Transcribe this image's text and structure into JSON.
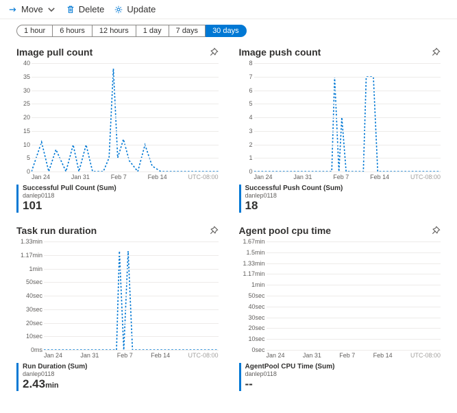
{
  "toolbar": {
    "move": "Move",
    "delete": "Delete",
    "update": "Update"
  },
  "time_ranges": [
    "1 hour",
    "6 hours",
    "12 hours",
    "1 day",
    "7 days",
    "30 days"
  ],
  "time_selected": 5,
  "x_labels": [
    "Jan 24",
    "Jan 31",
    "Feb 7",
    "Feb 14"
  ],
  "tz": "UTC-08:00",
  "cards": {
    "pull": {
      "title": "Image pull count",
      "y_ticks": [
        "40",
        "35",
        "30",
        "25",
        "20",
        "15",
        "10",
        "5",
        "0"
      ],
      "legend_name": "Successful Pull Count (Sum)",
      "legend_sub": "danlep0118",
      "legend_val": "101",
      "legend_unit": ""
    },
    "push": {
      "title": "Image push count",
      "y_ticks": [
        "8",
        "7",
        "6",
        "5",
        "4",
        "3",
        "2",
        "1",
        "0"
      ],
      "legend_name": "Successful Push Count (Sum)",
      "legend_sub": "danlep0118",
      "legend_val": "18",
      "legend_unit": ""
    },
    "task": {
      "title": "Task run duration",
      "y_ticks": [
        "1.33min",
        "1.17min",
        "1min",
        "50sec",
        "40sec",
        "30sec",
        "20sec",
        "10sec",
        "0ms"
      ],
      "legend_name": "Run Duration (Sum)",
      "legend_sub": "danlep0118",
      "legend_val": "2.43",
      "legend_unit": "min"
    },
    "agent": {
      "title": "Agent pool cpu time",
      "y_ticks": [
        "1.67min",
        "1.5min",
        "1.33min",
        "1.17min",
        "1min",
        "50sec",
        "40sec",
        "30sec",
        "20sec",
        "10sec",
        "0sec"
      ],
      "legend_name": "AgentPool CPU Time (Sum)",
      "legend_sub": "danlep0118",
      "legend_val": "--",
      "legend_unit": ""
    }
  },
  "chart_data": [
    {
      "type": "line",
      "title": "Image pull count",
      "x": [
        "Jan 23",
        "Jan 24",
        "Jan 25",
        "Jan 26",
        "Jan 28",
        "Jan 29",
        "Jan 30",
        "Jan 31",
        "Feb 1",
        "Feb 2",
        "Feb 3",
        "Feb 4",
        "Feb 5",
        "Feb 6",
        "Feb 7",
        "Feb 8",
        "Feb 9",
        "Feb 10",
        "Feb 19"
      ],
      "values": [
        0,
        11,
        0,
        8,
        10,
        0,
        10,
        0,
        0,
        5,
        38,
        5,
        12,
        4,
        0,
        10,
        2,
        0,
        0
      ],
      "ylabel": "",
      "ylim": [
        0,
        40
      ]
    },
    {
      "type": "line",
      "title": "Image push count",
      "x": [
        "Jan 23",
        "Feb 3",
        "Feb 4",
        "Feb 5",
        "Feb 8",
        "Feb 9",
        "Feb 10",
        "Feb 19"
      ],
      "values": [
        0,
        7,
        4,
        0,
        7,
        7,
        0,
        0
      ],
      "ylabel": "",
      "ylim": [
        0,
        8
      ]
    },
    {
      "type": "line",
      "title": "Task run duration",
      "x": [
        "Jan 23",
        "Feb 3",
        "Feb 4",
        "Feb 5",
        "Feb 19"
      ],
      "values": [
        0,
        1.22,
        1.22,
        0,
        0
      ],
      "ylabel": "minutes",
      "ylim": [
        0,
        1.33
      ]
    },
    {
      "type": "line",
      "title": "Agent pool cpu time",
      "x": [
        "Jan 23",
        "Feb 19"
      ],
      "values": [
        null,
        null
      ],
      "ylabel": "minutes",
      "ylim": [
        0,
        1.67
      ]
    }
  ]
}
